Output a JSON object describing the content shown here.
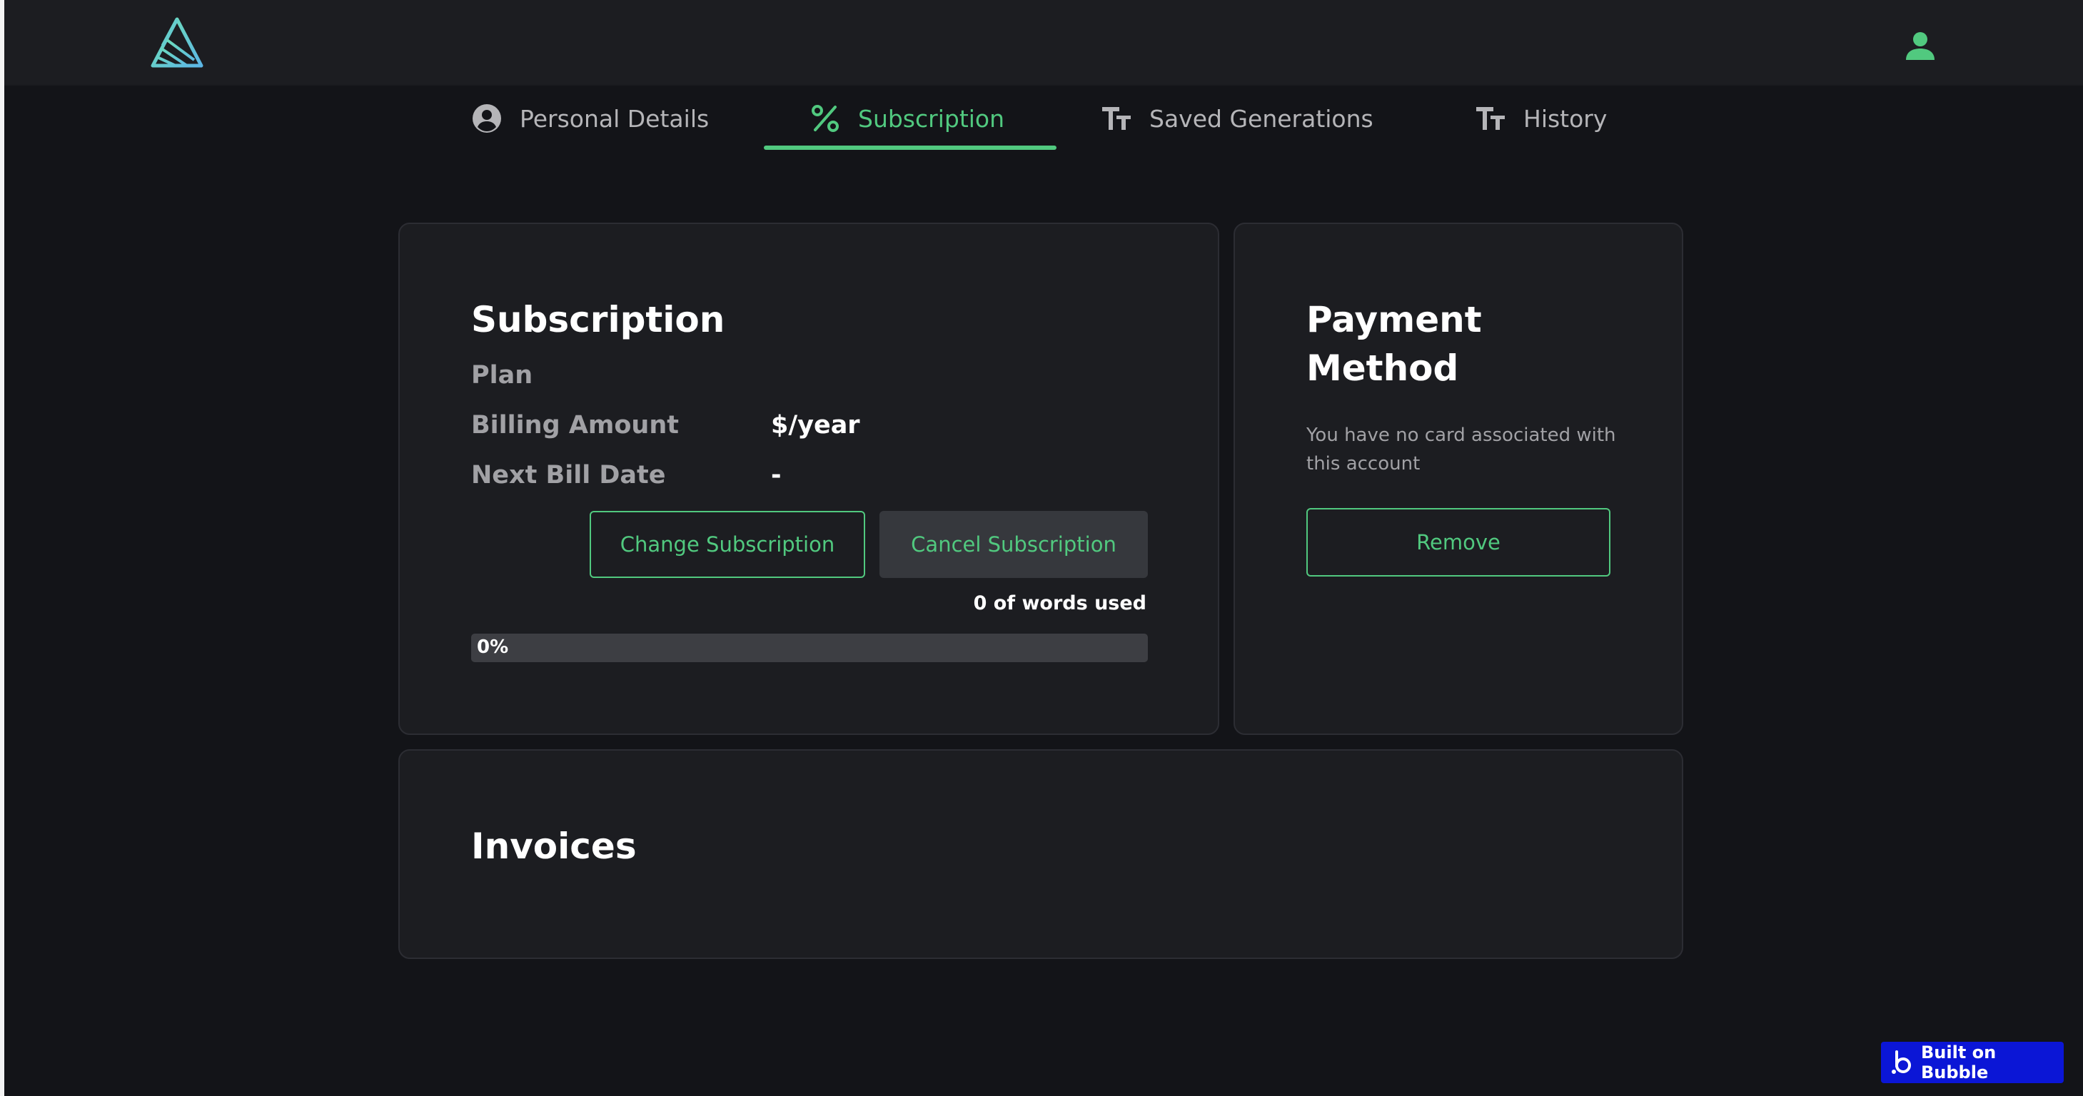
{
  "header": {
    "logo_icon": "triangle-logo-icon",
    "user_icon": "user-icon",
    "accent_color": "#51c97f"
  },
  "tabs": [
    {
      "label": "Personal Details",
      "icon": "account-circle-icon",
      "active": false
    },
    {
      "label": "Subscription",
      "icon": "percent-icon",
      "active": true
    },
    {
      "label": "Saved Generations",
      "icon": "text-size-icon",
      "active": false
    },
    {
      "label": "History",
      "icon": "text-size-icon",
      "active": false
    }
  ],
  "subscription": {
    "title": "Subscription",
    "plan_label": "Plan",
    "plan_value": "",
    "billing_label": "Billing Amount",
    "billing_value": "$/year",
    "next_bill_label": "Next Bill Date",
    "next_bill_value": "-",
    "change_button": "Change Subscription",
    "cancel_button": "Cancel Subscription",
    "words_used": "0 of  words used",
    "usage_percent_text": "0%",
    "usage_fraction": 0
  },
  "payment": {
    "title_line1": "Payment",
    "title_line2": "Method",
    "no_card_text": "You have no card associated with this account",
    "remove_button": "Remove"
  },
  "invoices": {
    "title": "Invoices"
  },
  "footer": {
    "badge_label": "Built on Bubble",
    "badge_icon": "bubble-logo-icon"
  }
}
